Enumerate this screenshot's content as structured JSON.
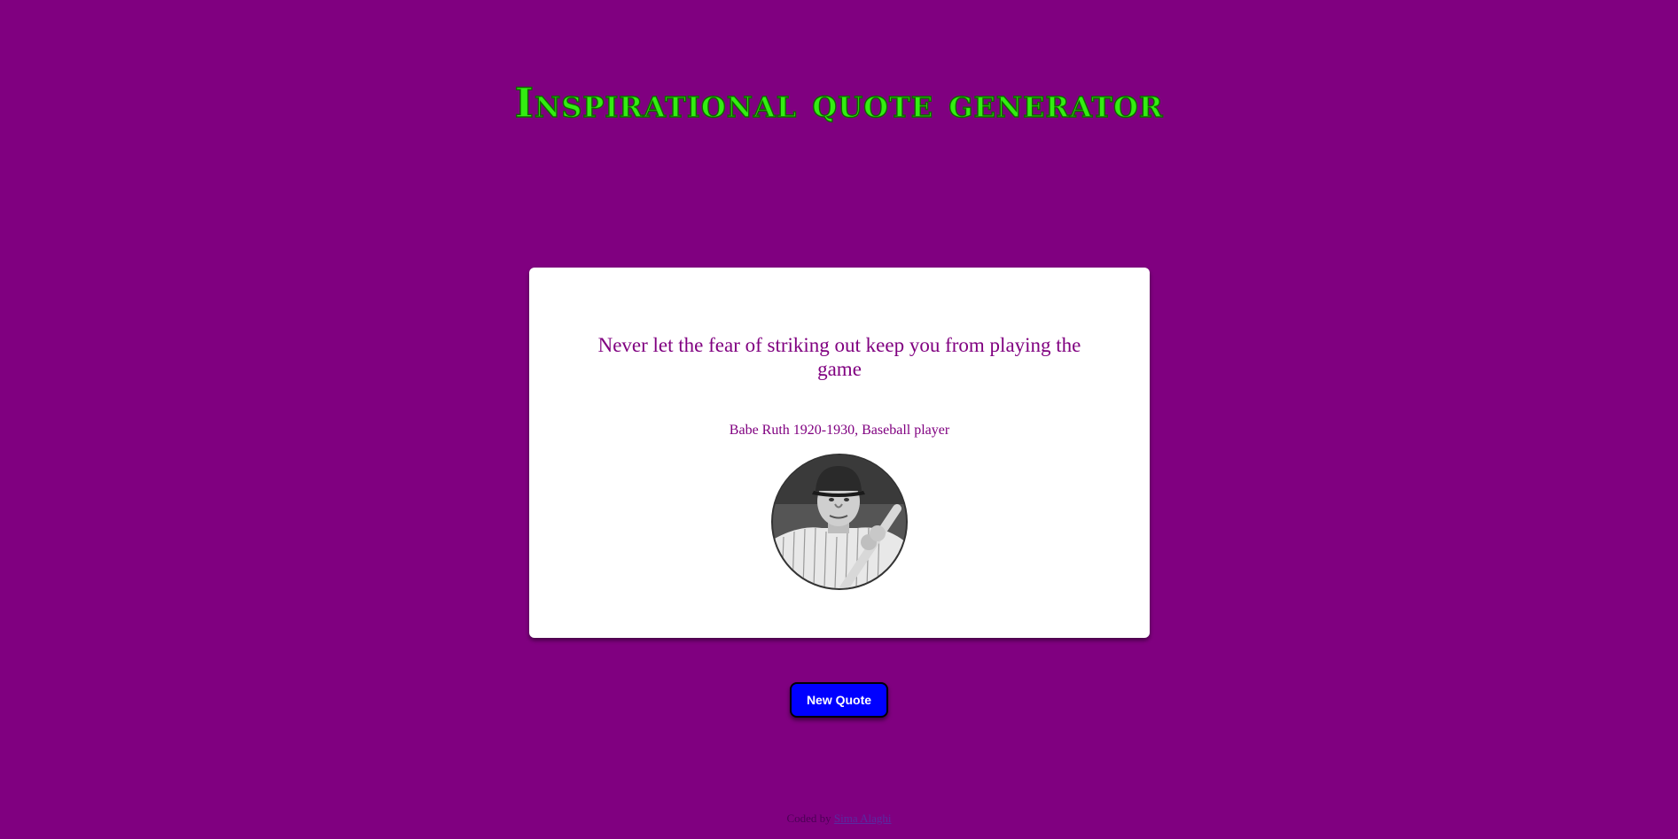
{
  "header": {
    "title": "Inspirational quote generator"
  },
  "quote": {
    "text": "Never let the fear of striking out keep you from playing the game",
    "author": "Babe Ruth 1920-1930, Baseball player",
    "portrait_icon": "person-photo-icon"
  },
  "actions": {
    "new_quote_label": "New Quote"
  },
  "footer": {
    "text": "Coded by",
    "link_text": "Sima Alaghi"
  },
  "colors": {
    "background": "#800080",
    "title": "#33ee11",
    "quote_text": "#800080",
    "card": "#ffffff",
    "button": "#0000ff"
  }
}
